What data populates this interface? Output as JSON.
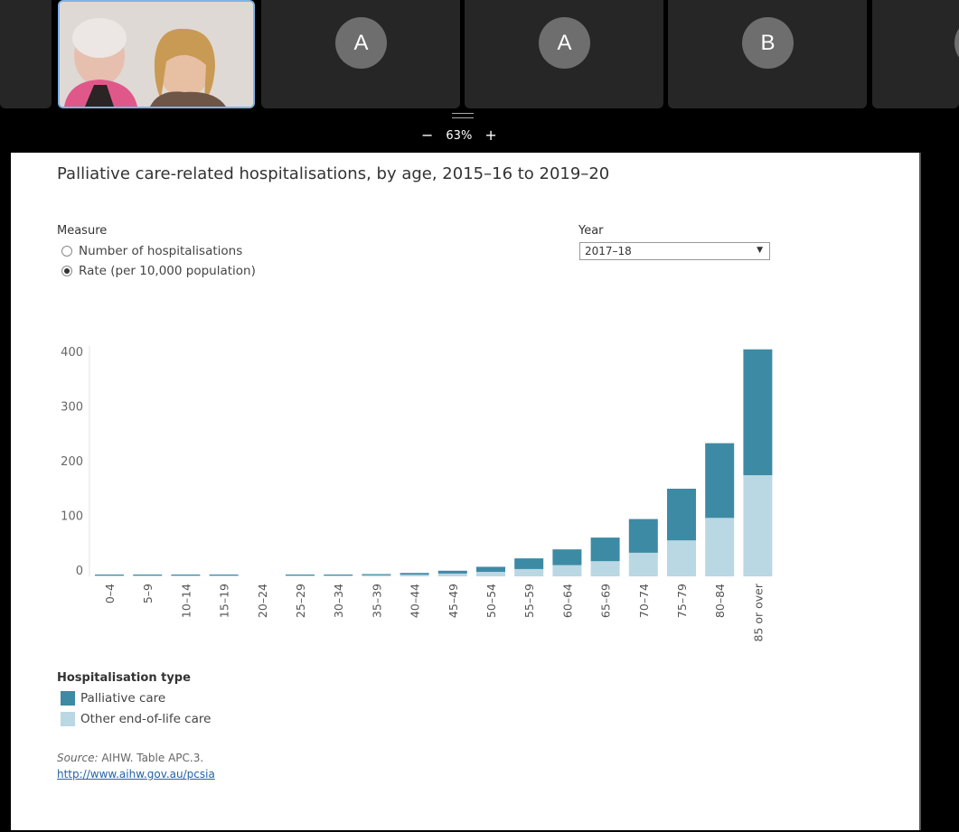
{
  "meeting": {
    "participants": [
      {
        "type": "video"
      },
      {
        "type": "avatar",
        "initial": "A"
      },
      {
        "type": "avatar",
        "initial": "A"
      },
      {
        "type": "avatar",
        "initial": "B"
      }
    ],
    "zoom": {
      "minus": "−",
      "level": "63%",
      "plus": "+"
    }
  },
  "page": {
    "title": "Palliative care-related hospitalisations, by age, 2015–16 to 2019–20",
    "measure": {
      "label": "Measure",
      "options": [
        "Number of hospitalisations",
        "Rate (per 10,000 population)"
      ],
      "selected": 1
    },
    "year": {
      "label": "Year",
      "value": "2017–18"
    },
    "legend": {
      "title": "Hospitalisation type",
      "items": [
        {
          "label": "Palliative care",
          "color": "#3d8aa5"
        },
        {
          "label": "Other end-of-life care",
          "color": "#b9d8e3"
        }
      ]
    },
    "source": {
      "prefix": "Source:",
      "text": " AIHW. Table APC.3.",
      "link": "http://www.aihw.gov.au/pcsia"
    }
  },
  "chart_data": {
    "type": "bar",
    "stacked": true,
    "categories": [
      "0–4",
      "5–9",
      "10–14",
      "15–19",
      "20–24",
      "25–29",
      "30–34",
      "35–39",
      "40–44",
      "45–49",
      "50–54",
      "55–59",
      "60–64",
      "65–69",
      "70–74",
      "75–79",
      "80–84",
      "85 or over"
    ],
    "series": [
      {
        "name": "Other end-of-life care",
        "color": "#b9d8e3",
        "values": [
          1,
          1,
          1,
          1,
          0,
          1,
          1,
          2,
          3,
          5,
          8,
          13,
          20,
          27,
          42,
          64,
          104,
          180
        ]
      },
      {
        "name": "Palliative care",
        "color": "#3d8aa5",
        "values": [
          1,
          1,
          1,
          1,
          0,
          1,
          1,
          2,
          3,
          5,
          9,
          19,
          28,
          42,
          60,
          92,
          133,
          224
        ]
      }
    ],
    "yticks": [
      0,
      100,
      200,
      300,
      400
    ],
    "ylim": [
      0,
      410
    ],
    "grid": false
  }
}
